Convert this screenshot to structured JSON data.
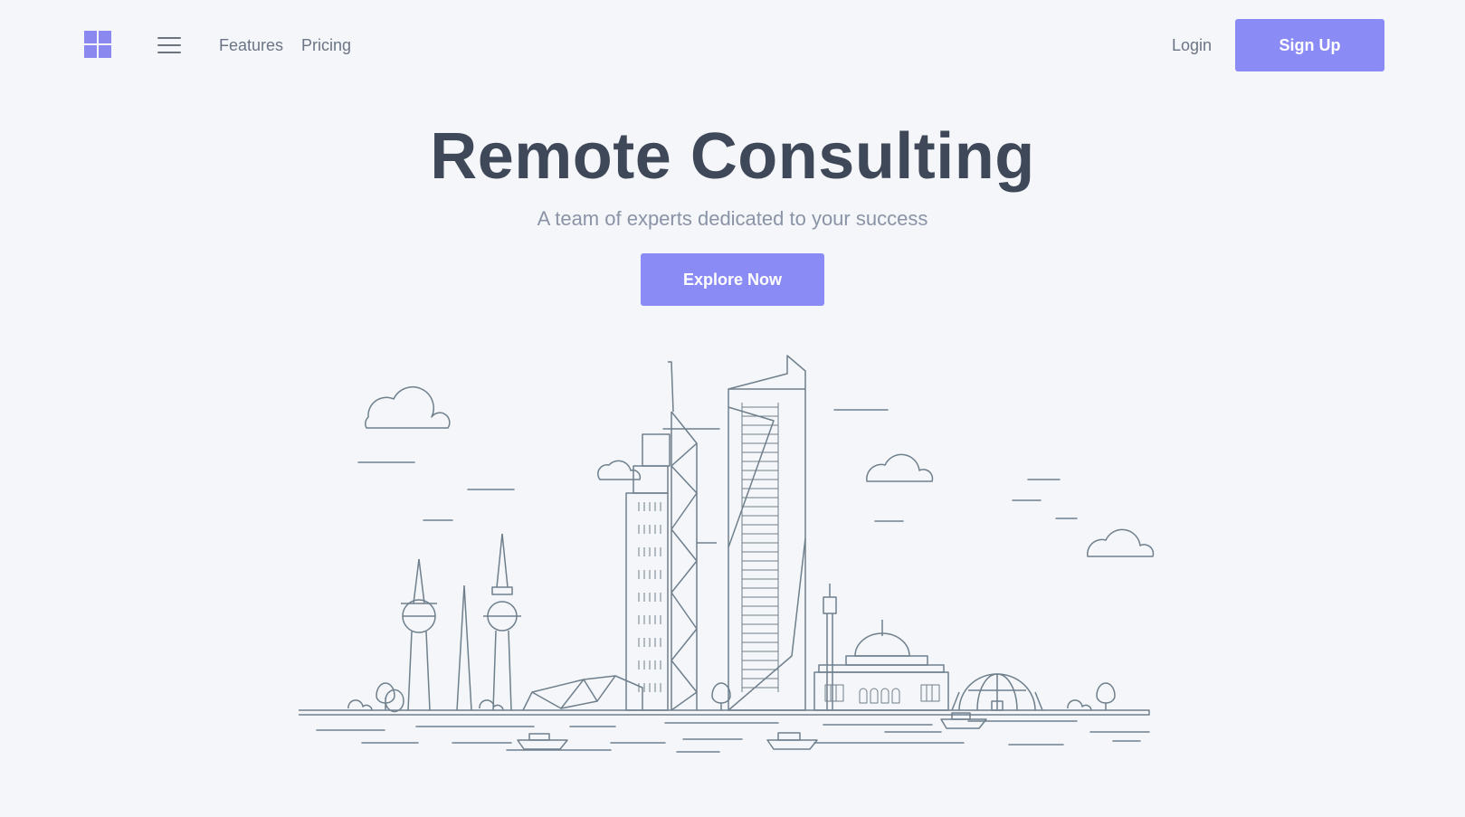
{
  "nav": {
    "logo_icon": "windows-grid-icon",
    "menu_icon": "hamburger-menu-icon",
    "links": [
      "Features",
      "Pricing"
    ],
    "login_label": "Login",
    "signup_label": "Sign Up"
  },
  "hero": {
    "title": "Remote Consulting",
    "subtitle": "A team of experts dedicated to your success",
    "cta_label": "Explore Now",
    "illustration": "city-skyline-illustration"
  },
  "colors": {
    "background": "#f4f6f9",
    "accent": "#8b8bf5",
    "heading": "#3f4858",
    "muted_text": "#8a94a6",
    "line_art": "#6f7f8c"
  }
}
